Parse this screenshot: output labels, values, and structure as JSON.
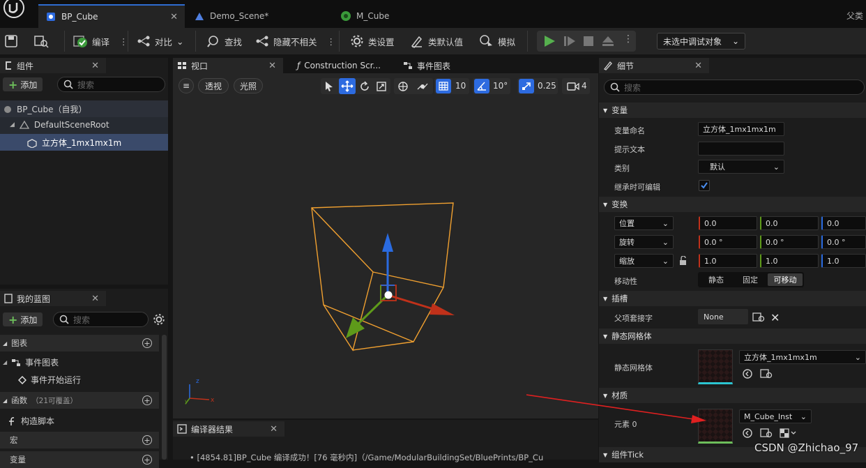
{
  "tabs": [
    {
      "label": "BP_Cube",
      "icon": "blueprint-icon"
    },
    {
      "label": "Demo_Scene*",
      "icon": "level-icon"
    },
    {
      "label": "M_Cube",
      "icon": "material-icon"
    }
  ],
  "parent_class_label": "父类",
  "toolbar": {
    "compile": "编译",
    "diff": "对比",
    "find": "查找",
    "hide_unrelated": "隐藏不相关",
    "class_settings": "类设置",
    "class_defaults": "类默认值",
    "simulate": "模拟",
    "debug_target": "未选中调试对象"
  },
  "components": {
    "title": "组件",
    "add": "添加",
    "search_placeholder": "搜索",
    "tree": [
      "BP_Cube（自我）",
      "DefaultSceneRoot",
      "立方体_1mx1mx1m"
    ]
  },
  "my_blueprint": {
    "title": "我的蓝图",
    "add": "添加",
    "search_placeholder": "搜索",
    "graphs": "图表",
    "event_graph": "事件图表",
    "event_begin_play": "事件开始运行",
    "functions": "函数",
    "functions_count": "（21可覆盖）",
    "construction_script": "构造脚本",
    "macros": "宏",
    "variables": "变量"
  },
  "viewport": {
    "tabs": [
      "视口",
      "Construction Scr...",
      "事件图表"
    ],
    "perspective": "透视",
    "lit": "光照",
    "grid_snap": "10",
    "rot_snap": "10°",
    "scale_snap": "0.25",
    "cam_speed": "4"
  },
  "compiler": {
    "title": "编译器结果",
    "log": "[4854.81]BP_Cube 编译成功！[76 毫秒内]（/Game/ModularBuildingSet/BluePrints/BP_Cu"
  },
  "details": {
    "title": "细节",
    "search_placeholder": "搜索",
    "sec_variable": "变量",
    "var_name_label": "变量命名",
    "var_name_value": "立方体_1mx1mx1m",
    "tooltip_label": "提示文本",
    "category_label": "类别",
    "category_value": "默认",
    "editable_inherit_label": "继承时可编辑",
    "sec_transform": "变换",
    "location": "位置",
    "rotation": "旋转",
    "scale": "缩放",
    "loc_values": [
      "0.0",
      "0.0",
      "0.0"
    ],
    "rot_values": [
      "0.0 °",
      "0.0 °",
      "0.0 °"
    ],
    "scale_values": [
      "1.0",
      "1.0",
      "1.0"
    ],
    "mobility_label": "移动性",
    "mobility_options": [
      "静态",
      "固定",
      "可移动"
    ],
    "sec_sockets": "插槽",
    "parent_socket_label": "父项套接字",
    "parent_socket_value": "None",
    "sec_static_mesh": "静态网格体",
    "static_mesh_label": "静态网格体",
    "static_mesh_value": "立方体_1mx1mx1m",
    "sec_materials": "材质",
    "element0_label": "元素 0",
    "element0_value": "M_Cube_Inst",
    "sec_component_tick": "组件Tick"
  },
  "watermark": "CSDN @Zhichao_97",
  "colors": {
    "accent": "#2e6cd1",
    "play": "#4caf50",
    "selection": "#ffa726",
    "arrow": "#e02020"
  }
}
